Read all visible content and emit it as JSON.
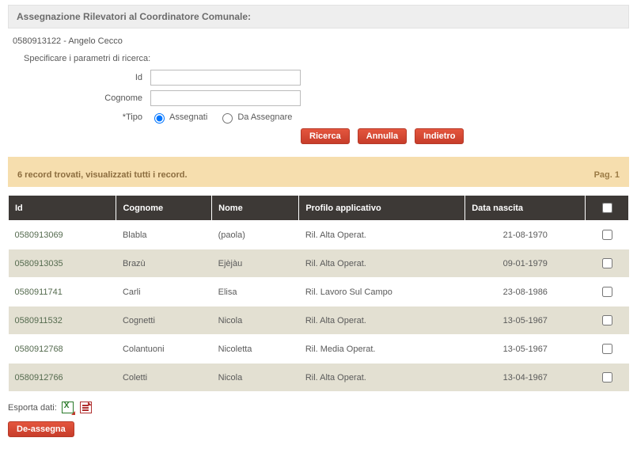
{
  "title": "Assegnazione Rilevatori al Coordinatore Comunale:",
  "coordinator": "0580913122 - Angelo Cecco",
  "search": {
    "instruction": "Specificare i parametri di ricerca:",
    "labels": {
      "id": "Id",
      "surname": "Cognome",
      "type": "*Tipo"
    },
    "values": {
      "id": "",
      "surname": ""
    },
    "type_options": {
      "assegnati": "Assegnati",
      "da_assegnare": "Da Assegnare"
    },
    "type_selected": "assegnati"
  },
  "buttons": {
    "search": "Ricerca",
    "cancel": "Annulla",
    "back": "Indietro",
    "deassign": "De-assegna"
  },
  "results": {
    "summary": "6 record trovati, visualizzati tutti i record.",
    "page_indicator": "Pag. 1"
  },
  "table": {
    "headers": {
      "id": "Id",
      "surname": "Cognome",
      "name": "Nome",
      "profile": "Profilo applicativo",
      "birth": "Data nascita"
    },
    "rows": [
      {
        "id": "0580913069",
        "surname": "Blabla",
        "name": "(paola)",
        "profile": "Ril. Alta Operat.",
        "birth": "21-08-1970"
      },
      {
        "id": "0580913035",
        "surname": "Brazù",
        "name": "Ejèjàu",
        "profile": "Ril. Alta Operat.",
        "birth": "09-01-1979"
      },
      {
        "id": "0580911741",
        "surname": "Carli",
        "name": "Elisa",
        "profile": "Ril. Lavoro Sul Campo",
        "birth": "23-08-1986"
      },
      {
        "id": "0580911532",
        "surname": "Cognetti",
        "name": "Nicola",
        "profile": "Ril. Alta Operat.",
        "birth": "13-05-1967"
      },
      {
        "id": "0580912768",
        "surname": "Colantuoni",
        "name": "Nicoletta",
        "profile": "Ril. Media Operat.",
        "birth": "13-05-1967"
      },
      {
        "id": "0580912766",
        "surname": "Coletti",
        "name": "Nicola",
        "profile": "Ril. Alta Operat.",
        "birth": "13-04-1967"
      }
    ]
  },
  "export": {
    "label": "Esporta dati:"
  }
}
